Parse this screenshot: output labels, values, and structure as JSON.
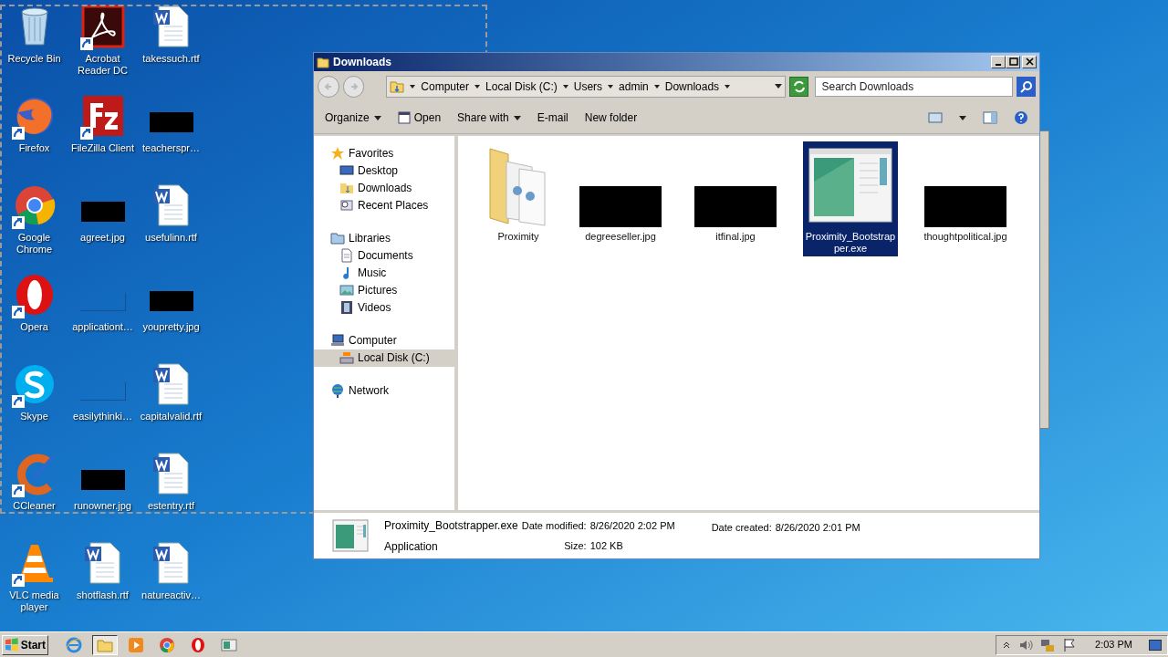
{
  "desktop_icons": [
    {
      "label": "Recycle Bin",
      "kind": "recycle",
      "shortcut": false
    },
    {
      "label": "Acrobat Reader DC",
      "kind": "acrobat",
      "shortcut": true
    },
    {
      "label": "takessuch.rtf",
      "kind": "word",
      "shortcut": false
    },
    {
      "label": "Firefox",
      "kind": "firefox",
      "shortcut": true
    },
    {
      "label": "FileZilla Client",
      "kind": "filezilla",
      "shortcut": true
    },
    {
      "label": "teacherspr…",
      "kind": "redacted",
      "shortcut": false
    },
    {
      "label": "Google Chrome",
      "kind": "chrome",
      "shortcut": true
    },
    {
      "label": "agreet.jpg",
      "kind": "redacted",
      "shortcut": false
    },
    {
      "label": "usefulinn.rtf",
      "kind": "word",
      "shortcut": false
    },
    {
      "label": "Opera",
      "kind": "opera",
      "shortcut": true
    },
    {
      "label": "applicationt…",
      "kind": "blank",
      "shortcut": false
    },
    {
      "label": "youpretty.jpg",
      "kind": "redacted",
      "shortcut": false
    },
    {
      "label": "Skype",
      "kind": "skype",
      "shortcut": true
    },
    {
      "label": "easilythinki…",
      "kind": "blank",
      "shortcut": false
    },
    {
      "label": "capitalvalid.rtf",
      "kind": "word",
      "shortcut": false
    },
    {
      "label": "CCleaner",
      "kind": "ccleaner",
      "shortcut": true
    },
    {
      "label": "runowner.jpg",
      "kind": "redacted",
      "shortcut": false
    },
    {
      "label": "estentry.rtf",
      "kind": "word",
      "shortcut": false
    },
    {
      "label": "VLC media player",
      "kind": "vlc",
      "shortcut": true
    },
    {
      "label": "shotflash.rtf",
      "kind": "word",
      "shortcut": false
    },
    {
      "label": "natureactiv…",
      "kind": "word",
      "shortcut": false
    }
  ],
  "window": {
    "title": "Downloads",
    "breadcrumb": [
      "Computer",
      "Local Disk (C:)",
      "Users",
      "admin",
      "Downloads"
    ],
    "search": {
      "placeholder": "Search Downloads"
    },
    "commands": [
      {
        "label": "Organize",
        "kind": "menu"
      },
      {
        "label": "Open",
        "kind": "icon"
      },
      {
        "label": "Share with",
        "kind": "menu"
      },
      {
        "label": "E-mail",
        "kind": "plain"
      },
      {
        "label": "New folder",
        "kind": "plain"
      }
    ],
    "nav": [
      {
        "label": "Favorites",
        "kind": "star",
        "selected": false,
        "children": [
          {
            "label": "Desktop",
            "kind": "desktop",
            "selected": false
          },
          {
            "label": "Downloads",
            "kind": "downloads",
            "selected": false
          },
          {
            "label": "Recent Places",
            "kind": "recent",
            "selected": false
          }
        ]
      },
      {
        "label": "Libraries",
        "kind": "libraries",
        "selected": false,
        "children": [
          {
            "label": "Documents",
            "kind": "documents",
            "selected": false
          },
          {
            "label": "Music",
            "kind": "music",
            "selected": false
          },
          {
            "label": "Pictures",
            "kind": "pictures",
            "selected": false
          },
          {
            "label": "Videos",
            "kind": "videos",
            "selected": false
          }
        ]
      },
      {
        "label": "Computer",
        "kind": "computer",
        "selected": false,
        "children": [
          {
            "label": "Local Disk (C:)",
            "kind": "disk",
            "selected": true
          }
        ]
      },
      {
        "label": "Network",
        "kind": "network",
        "selected": false
      }
    ],
    "files": [
      {
        "name": "Proximity",
        "kind": "folder",
        "selected": false
      },
      {
        "name": "degreeseller.jpg",
        "kind": "redacted",
        "selected": false
      },
      {
        "name": "itfinal.jpg",
        "kind": "redacted",
        "selected": false
      },
      {
        "name": "Proximity_Bootstrapper.exe",
        "kind": "exe",
        "selected": true
      },
      {
        "name": "thoughtpolitical.jpg",
        "kind": "redacted",
        "selected": false
      }
    ],
    "details": {
      "name": "Proximity_Bootstrapper.exe",
      "type": "Application",
      "fields": [
        {
          "label": "Date modified:",
          "value": "8/26/2020 2:02 PM"
        },
        {
          "label": "Size:",
          "value": "102 KB"
        },
        {
          "label": "Date created:",
          "value": "8/26/2020 2:01 PM"
        }
      ]
    }
  },
  "taskbar": {
    "start": "Start",
    "apps": [
      {
        "kind": "ie",
        "selected": false
      },
      {
        "kind": "explorer",
        "selected": true
      },
      {
        "kind": "media",
        "selected": false
      },
      {
        "kind": "chrome",
        "selected": false
      },
      {
        "kind": "opera",
        "selected": false
      },
      {
        "kind": "app",
        "selected": false
      }
    ],
    "time": "2:03 PM"
  }
}
